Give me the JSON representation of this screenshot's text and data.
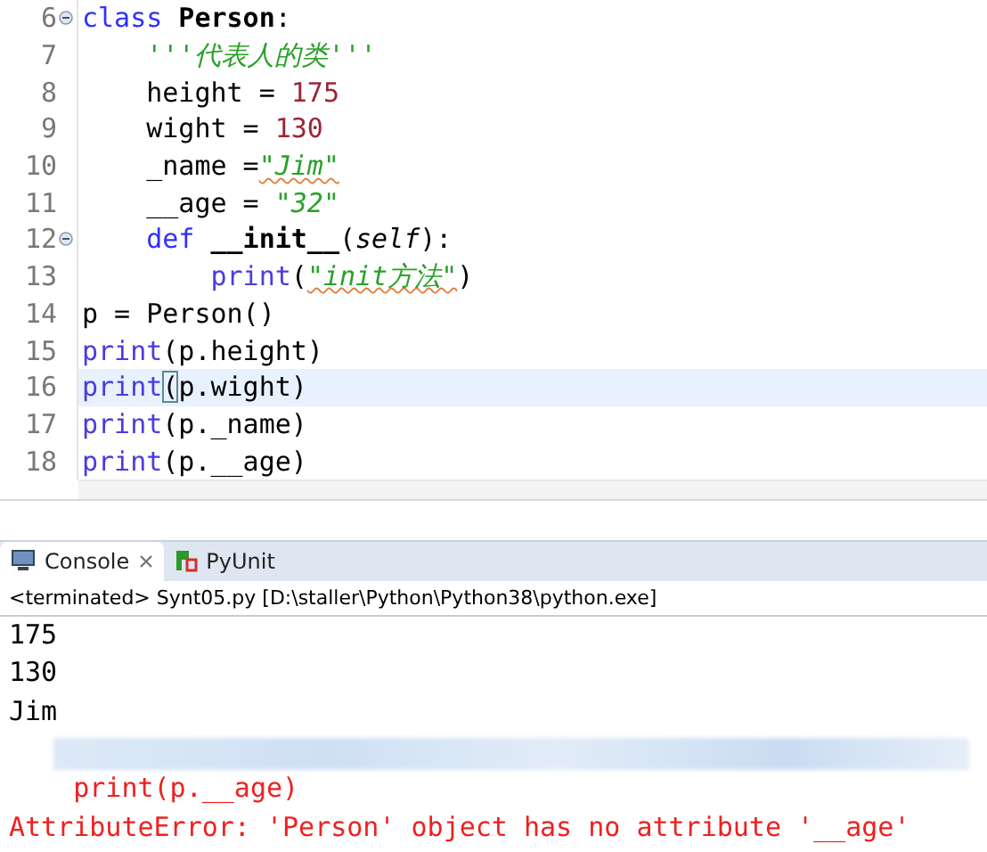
{
  "editor": {
    "lines": [
      {
        "number": "6",
        "fold": true,
        "current": false,
        "tokens": [
          {
            "kind": "keyword",
            "text": "class"
          },
          {
            "kind": "name",
            "text": " Person"
          },
          {
            "kind": "plain",
            "text": ":"
          }
        ]
      },
      {
        "number": "7",
        "fold": false,
        "current": false,
        "tokens": [
          {
            "kind": "string",
            "text": "    '''代表人的类'''"
          }
        ]
      },
      {
        "number": "8",
        "fold": false,
        "current": false,
        "tokens": [
          {
            "kind": "plain",
            "text": "    height = "
          },
          {
            "kind": "number",
            "text": "175"
          }
        ]
      },
      {
        "number": "9",
        "fold": false,
        "current": false,
        "tokens": [
          {
            "kind": "plain",
            "text": "    wight = "
          },
          {
            "kind": "number",
            "text": "130"
          }
        ]
      },
      {
        "number": "10",
        "fold": false,
        "current": false,
        "tokens": [
          {
            "kind": "plain",
            "text": "    _name ="
          },
          {
            "kind": "string",
            "text": "\"Jim\"",
            "spell": true
          }
        ]
      },
      {
        "number": "11",
        "fold": false,
        "current": false,
        "tokens": [
          {
            "kind": "plain",
            "text": "    __age = "
          },
          {
            "kind": "string",
            "text": "\"32\""
          }
        ]
      },
      {
        "number": "12",
        "fold": true,
        "current": false,
        "tokens": [
          {
            "kind": "keyword",
            "text": "    def"
          },
          {
            "kind": "name",
            "text": " __init__"
          },
          {
            "kind": "plain",
            "text": "("
          },
          {
            "kind": "self",
            "text": "self"
          },
          {
            "kind": "plain",
            "text": "):"
          }
        ]
      },
      {
        "number": "13",
        "fold": false,
        "current": false,
        "tokens": [
          {
            "kind": "builtin",
            "text": "        print"
          },
          {
            "kind": "plain",
            "text": "("
          },
          {
            "kind": "string",
            "text": "\"init方法\"",
            "spell": true
          },
          {
            "kind": "plain",
            "text": ")"
          }
        ]
      },
      {
        "number": "14",
        "fold": false,
        "current": false,
        "tokens": [
          {
            "kind": "plain",
            "text": "p = Person()"
          }
        ]
      },
      {
        "number": "15",
        "fold": false,
        "current": false,
        "tokens": [
          {
            "kind": "builtin",
            "text": "print"
          },
          {
            "kind": "plain",
            "text": "(p.height)"
          }
        ]
      },
      {
        "number": "16",
        "fold": false,
        "current": true,
        "tokens": [
          {
            "kind": "builtin",
            "text": "print"
          },
          {
            "kind": "bracket",
            "text": "("
          },
          {
            "kind": "plain",
            "text": "p.wight)"
          }
        ]
      },
      {
        "number": "17",
        "fold": false,
        "current": false,
        "tokens": [
          {
            "kind": "builtin",
            "text": "print"
          },
          {
            "kind": "plain",
            "text": "(p._name)"
          }
        ]
      },
      {
        "number": "18",
        "fold": false,
        "current": false,
        "tokens": [
          {
            "kind": "builtin",
            "text": "print"
          },
          {
            "kind": "plain",
            "text": "(p.__age)"
          }
        ]
      }
    ]
  },
  "console": {
    "tabs": [
      {
        "label": "Console",
        "selected": true,
        "closable": true
      },
      {
        "label": "PyUnit",
        "selected": false,
        "closable": false
      }
    ],
    "status": "<terminated> Synt05.py [D:\\staller\\Python\\Python38\\python.exe]",
    "output": [
      {
        "kind": "out",
        "text": "175"
      },
      {
        "kind": "out",
        "text": "130"
      },
      {
        "kind": "out",
        "text": "Jim"
      },
      {
        "kind": "blurred"
      },
      {
        "kind": "err",
        "text": "    print(p.__age)"
      },
      {
        "kind": "err",
        "text": "AttributeError: 'Person' object has no attribute '__age'"
      }
    ]
  }
}
